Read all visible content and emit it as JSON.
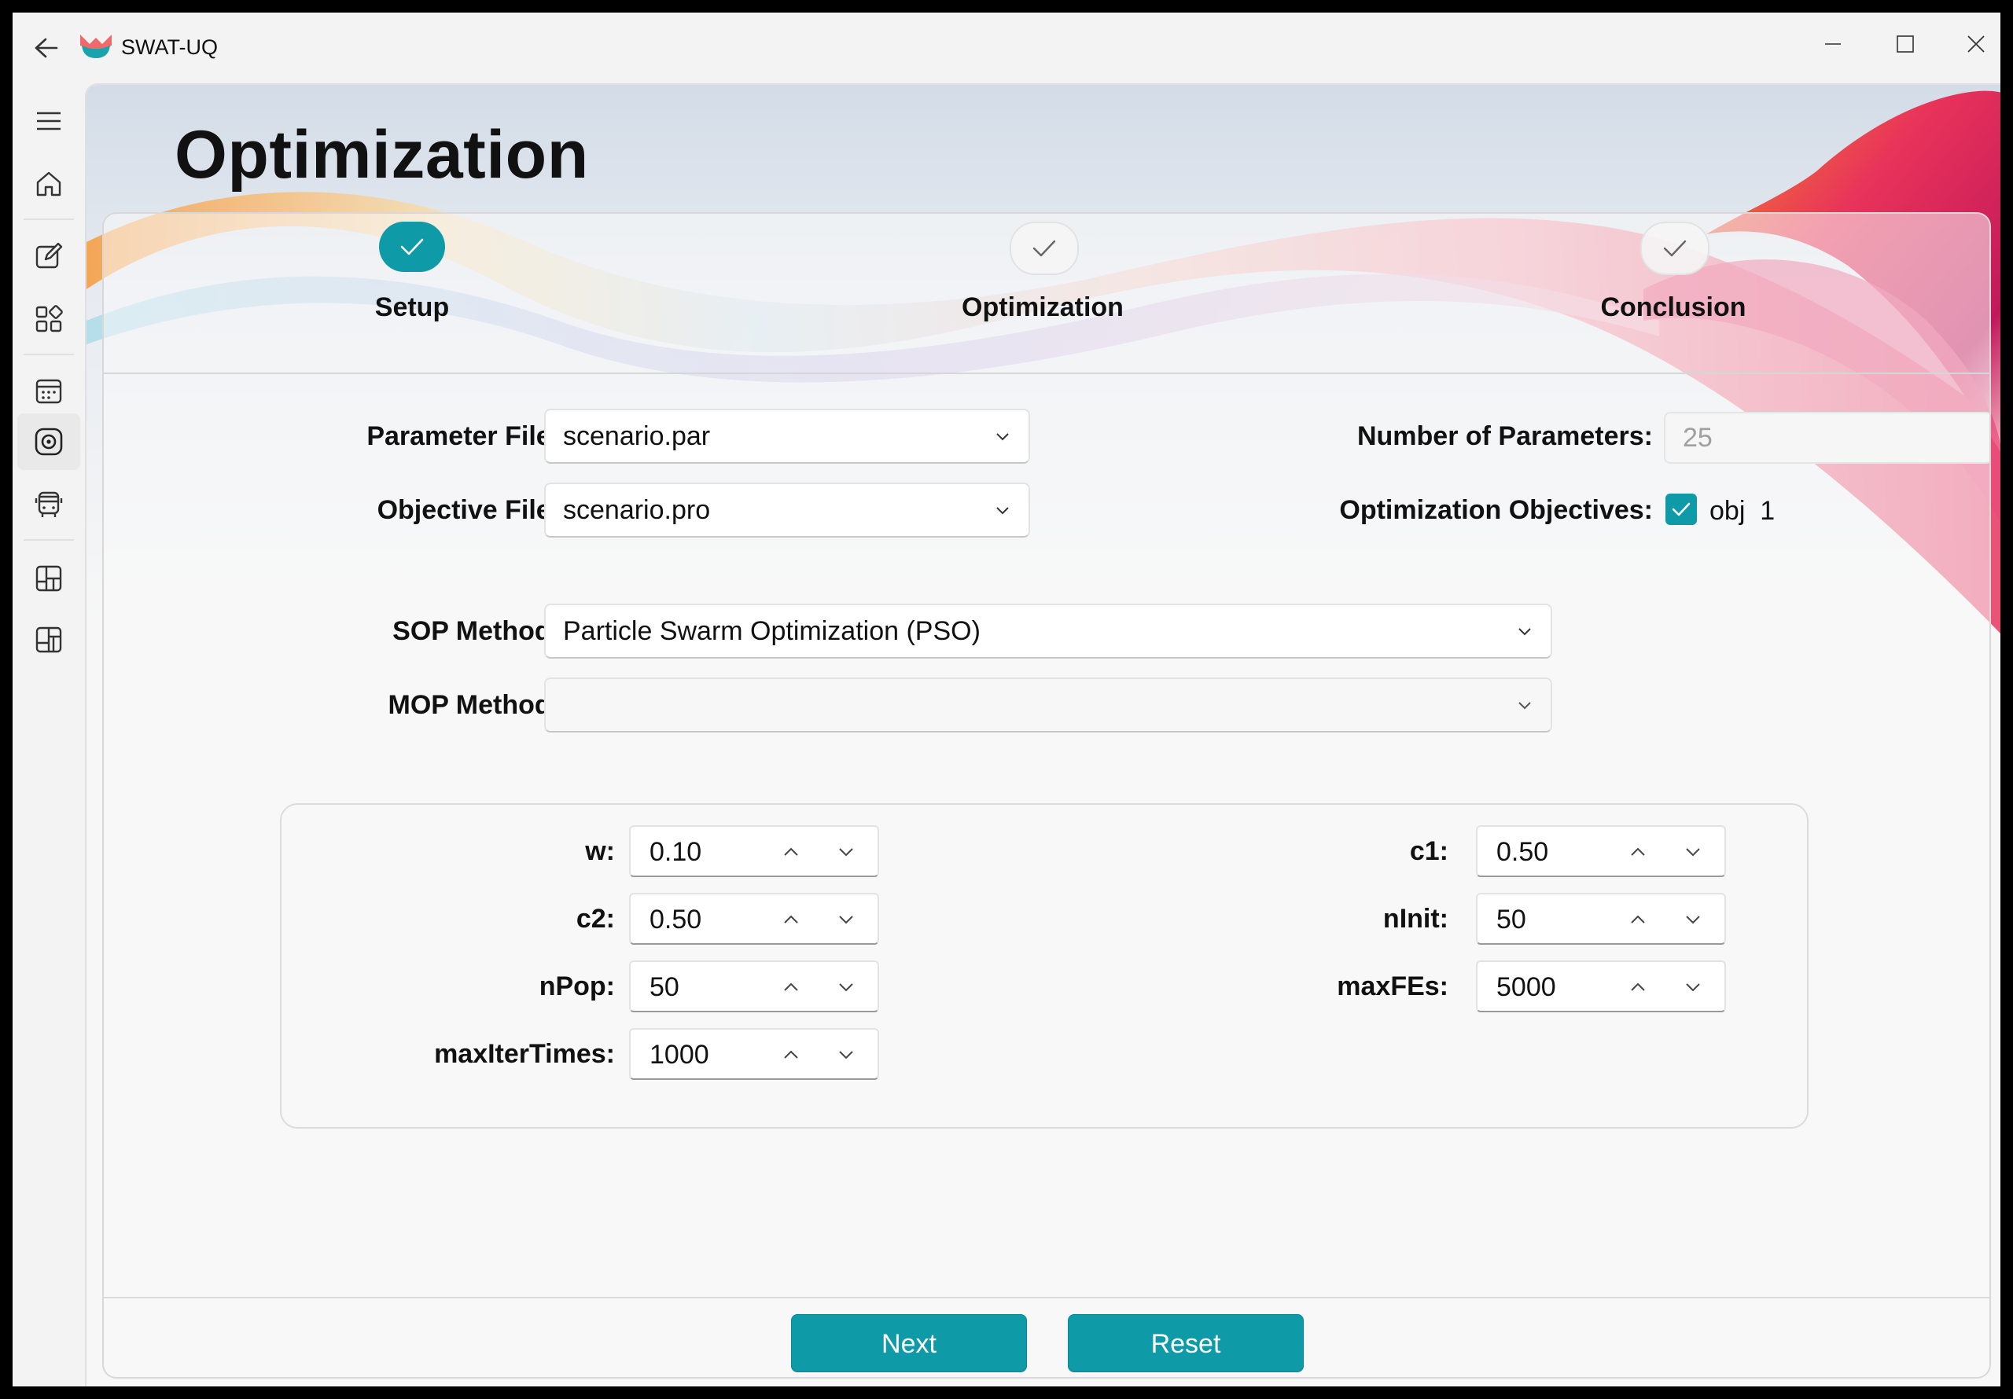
{
  "window": {
    "app_title": "SWAT-UQ"
  },
  "page": {
    "title": "Optimization"
  },
  "steps": [
    {
      "label": "Setup",
      "state": "done"
    },
    {
      "label": "Optimization",
      "state": "pending"
    },
    {
      "label": "Conclusion",
      "state": "pending"
    }
  ],
  "form": {
    "parameter_file_label": "Parameter File:",
    "parameter_file_value": "scenario.par",
    "objective_file_label": "Objective File:",
    "objective_file_value": "scenario.pro",
    "num_params_label": "Number of Parameters:",
    "num_params_value": "25",
    "opt_objectives_label": "Optimization Objectives:",
    "objective_option": "obj  1",
    "objective_checked": true,
    "sop_label": "SOP Method:",
    "sop_value": "Particle Swarm Optimization (PSO)",
    "mop_label": "MOP Method:",
    "mop_value": ""
  },
  "params": {
    "w_label": "w:",
    "w_value": "0.10",
    "c1_label": "c1:",
    "c1_value": "0.50",
    "c2_label": "c2:",
    "c2_value": "0.50",
    "ninit_label": "nInit:",
    "ninit_value": "50",
    "npop_label": "nPop:",
    "npop_value": "50",
    "maxfes_label": "maxFEs:",
    "maxfes_value": "5000",
    "maxiter_label": "maxIterTimes:",
    "maxiter_value": "1000"
  },
  "buttons": {
    "next": "Next",
    "reset": "Reset"
  },
  "colors": {
    "accent": "#0e9aa7",
    "background": "#f3f3f3"
  },
  "icons": {
    "nav": [
      "menu-icon",
      "home-icon",
      "edit-icon",
      "apps-icon",
      "calendar-icon",
      "target-icon",
      "bus-icon",
      "dashboard-icon",
      "dashboard-alt-icon"
    ]
  }
}
